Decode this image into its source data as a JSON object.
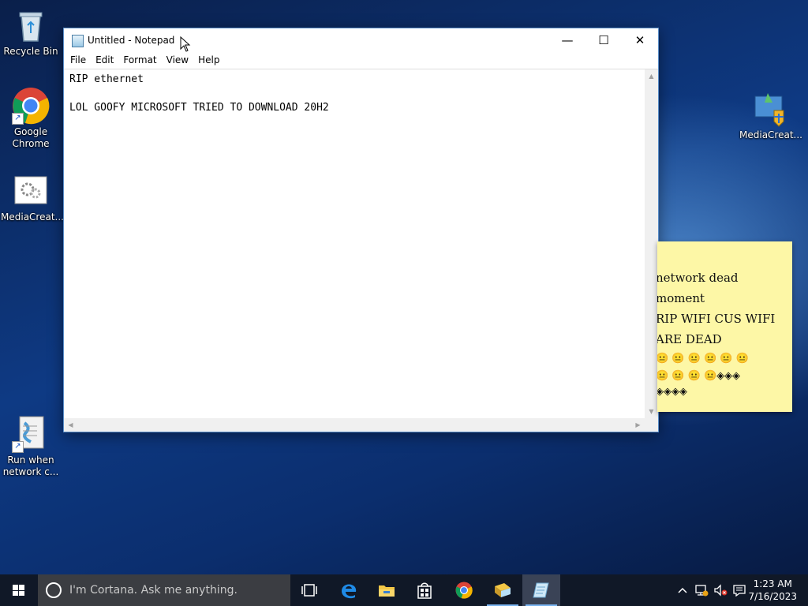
{
  "desktop": {
    "icons": [
      {
        "name": "recycle-bin",
        "label": "Recycle Bin"
      },
      {
        "name": "google-chrome",
        "label": "Google Chrome"
      },
      {
        "name": "mediacreation-1",
        "label": "MediaCreat..."
      },
      {
        "name": "run-when-network",
        "label": "Run when network c..."
      },
      {
        "name": "mediacreation-2",
        "label": "MediaCreat..."
      }
    ]
  },
  "notepad": {
    "title": "Untitled - Notepad",
    "menu": [
      "File",
      "Edit",
      "Format",
      "View",
      "Help"
    ],
    "content_lines": [
      "RIP ethernet",
      "",
      "LOL GOOFY MICROSOFT TRIED TO DOWNLOAD 20H2"
    ]
  },
  "sticky_note": {
    "lines": [
      "network dead",
      "moment",
      "RIP WIFI CUS WIFI",
      "ARE DEAD",
      "😐 😐 😐 😐 😐 😐",
      "😐 😐 😐 😐◈◈◈",
      "◈◈◈◈"
    ]
  },
  "taskbar": {
    "search_placeholder": "I'm Cortana. Ask me anything.",
    "pinned": [
      "task-view",
      "edge",
      "file-explorer",
      "store",
      "chrome",
      "mediacreation",
      "notepad"
    ],
    "clock_time": "1:23 AM",
    "clock_date": "7/16/2023"
  },
  "colors": {
    "taskbar": "#101827",
    "sticky": "#fdf7a6",
    "accent": "#7ab4f0"
  }
}
